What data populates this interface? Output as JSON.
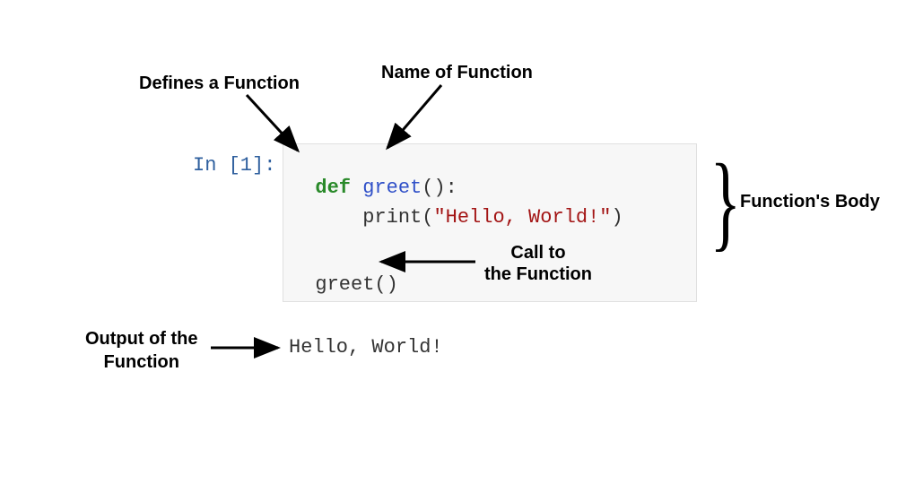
{
  "labels": {
    "defines": "Defines a Function",
    "name": "Name of Function",
    "body": "Function's Body",
    "call": "Call to\nthe Function",
    "output": "Output of the\nFunction"
  },
  "prompt": "In [1]:",
  "code": {
    "def_kw": "def",
    "func_name": "greet",
    "open_paren": "(",
    "close_paren": ")",
    "colon": ":",
    "indent": "    ",
    "print_builtin": "print",
    "string_literal": "\"Hello, World!\"",
    "call_name": "greet",
    "call_parens": "()"
  },
  "output": "Hello, World!"
}
